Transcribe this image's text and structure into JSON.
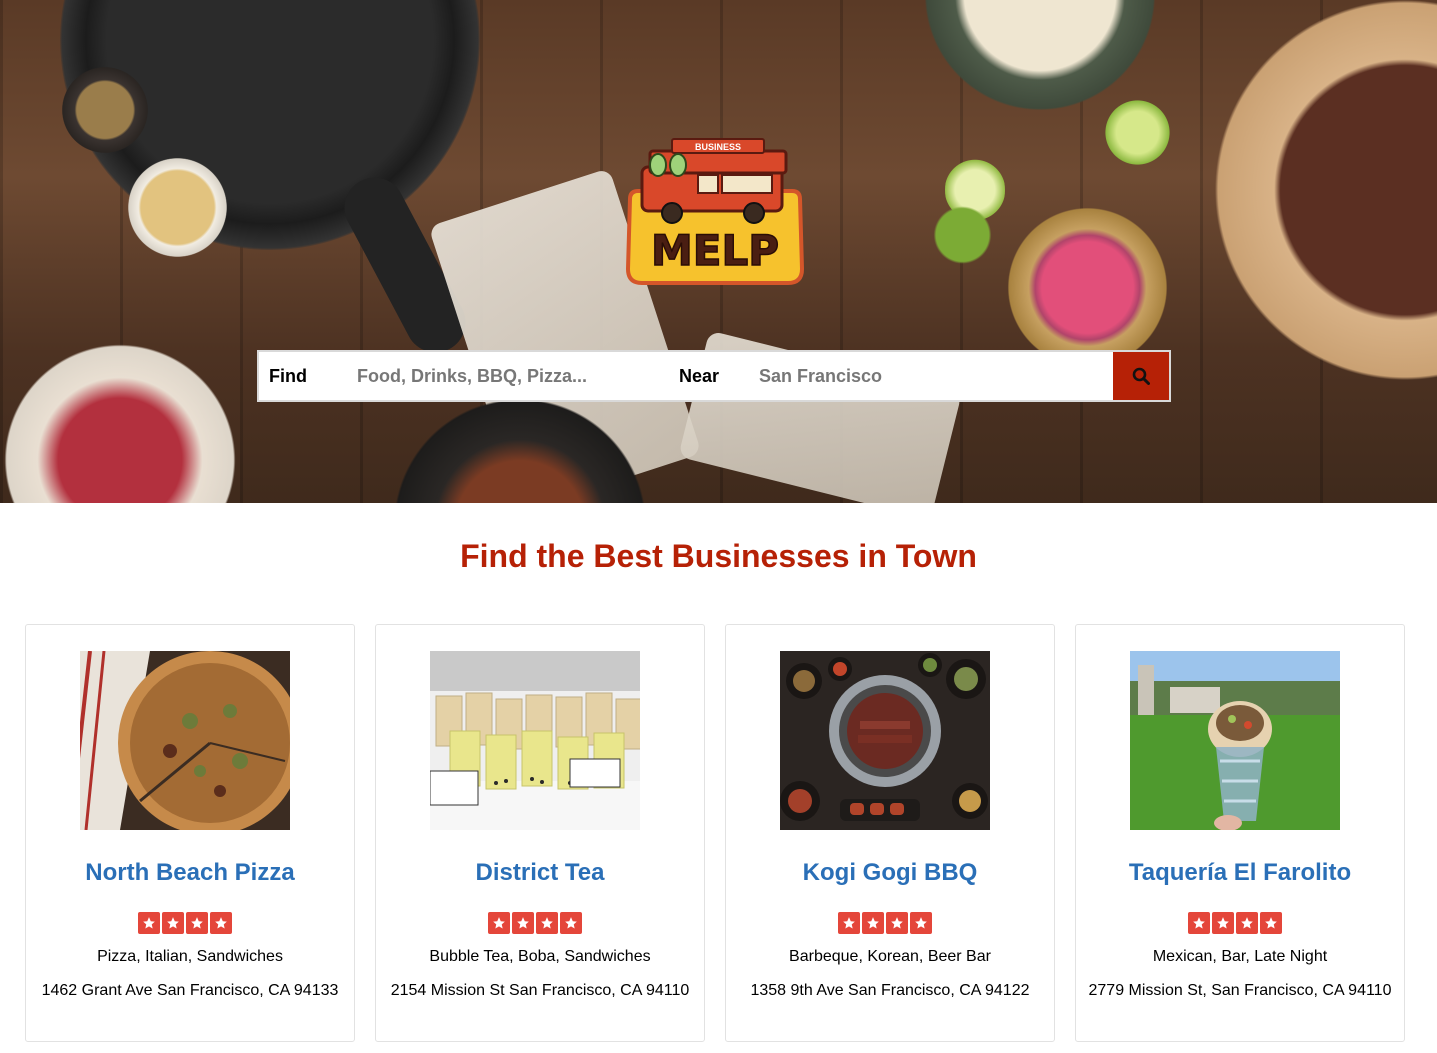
{
  "app": {
    "logo_banner": "BUSINESS",
    "logo_text": "MELP"
  },
  "search": {
    "find_label": "Find",
    "find_placeholder": "Food, Drinks, BBQ, Pizza...",
    "near_label": "Near",
    "near_placeholder": "San Francisco",
    "button_icon": "search-icon"
  },
  "main": {
    "title": "Find the Best Businesses in Town"
  },
  "businesses": [
    {
      "name": "North Beach Pizza",
      "rating_stars": 4,
      "categories": "Pizza, Italian, Sandwiches",
      "address": "1462 Grant Ave San Francisco, CA 94133",
      "image": "pizza-photo"
    },
    {
      "name": "District Tea",
      "rating_stars": 4,
      "categories": "Bubble Tea, Boba, Sandwiches",
      "address": "2154 Mission St San Francisco, CA 94110",
      "image": "bubble-tea-photo"
    },
    {
      "name": "Kogi Gogi BBQ",
      "rating_stars": 4,
      "categories": "Barbeque, Korean, Beer Bar",
      "address": "1358 9th Ave San Francisco, CA 94122",
      "image": "korean-bbq-photo"
    },
    {
      "name": "Taquería El Farolito",
      "rating_stars": 4,
      "categories": "Mexican, Bar, Late Night",
      "address": "2779 Mission St, San Francisco, CA 94110",
      "image": "burrito-photo"
    }
  ],
  "colors": {
    "brand_red": "#b62106",
    "link_blue": "#2a6fb7",
    "star_red": "#e4463a"
  }
}
